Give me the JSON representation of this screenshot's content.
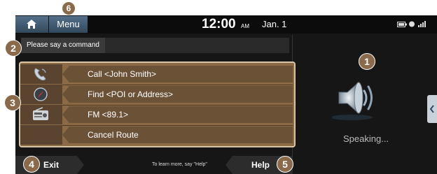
{
  "header": {
    "menu_label": "Menu",
    "time": "12:00",
    "ampm": "AM",
    "date": "Jan. 1"
  },
  "prompt": {
    "text": "Please say a command"
  },
  "commands": [
    {
      "icon": "phone-icon",
      "label": "Call <John Smith>"
    },
    {
      "icon": "compass-icon",
      "label": "Find <POI or Address>"
    },
    {
      "icon": "radio-icon",
      "label": "FM <89.1>"
    },
    {
      "icon": "",
      "label": "Cancel Route"
    }
  ],
  "footer": {
    "exit_label": "Exit",
    "hint": "To learn more, say \"Help\"",
    "help_label": "Help"
  },
  "status": {
    "speaking": "Speaking..."
  },
  "callouts": {
    "c1": "1",
    "c2": "2",
    "c3": "3",
    "c4": "4",
    "c5": "5",
    "c6": "6"
  },
  "colors": {
    "panel": "#8d6a46",
    "panel_border": "#d8c4a6",
    "callout": "#8a6a4a",
    "header_button": "#55708a"
  }
}
